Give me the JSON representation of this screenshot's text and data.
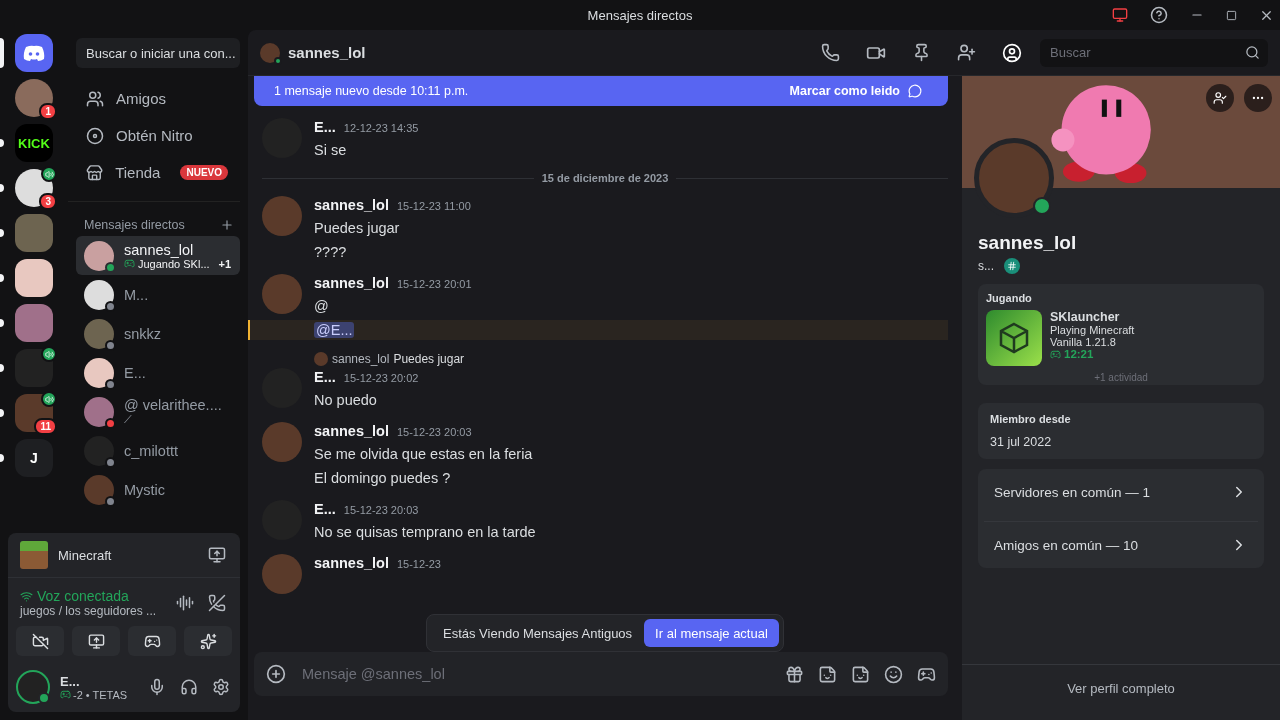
{
  "window": {
    "title": "Mensajes directos"
  },
  "servers": [
    {
      "kind": "home",
      "unread": false,
      "selected": true
    },
    {
      "kind": "avatar",
      "badge": "1",
      "voice": false,
      "unread": false,
      "selected": false
    },
    {
      "kind": "text",
      "label": "KICK",
      "unread": true,
      "selected": false
    },
    {
      "kind": "avatar",
      "badge": "3",
      "voice": true,
      "unread": true,
      "selected": false
    },
    {
      "kind": "avatar",
      "voice": false,
      "unread": true,
      "selected": false
    },
    {
      "kind": "avatar",
      "voice": false,
      "unread": true,
      "selected": false
    },
    {
      "kind": "avatar",
      "voice": false,
      "unread": true,
      "selected": false
    },
    {
      "kind": "avatar",
      "voice": true,
      "unread": true,
      "selected": false
    },
    {
      "kind": "avatar",
      "badge": "11",
      "voice": true,
      "unread": true,
      "selected": false
    },
    {
      "kind": "letter",
      "label": "J",
      "unread": true,
      "selected": false
    }
  ],
  "sidebar": {
    "search": "Buscar o iniciar una con...",
    "nav": [
      {
        "kind": "friends",
        "label": "Amigos"
      },
      {
        "kind": "nitro",
        "label": "Obtén Nitro"
      },
      {
        "kind": "shop",
        "label": "Tienda",
        "badge": "NUEVO"
      }
    ],
    "dm_header": "Mensajes directos",
    "dms": [
      {
        "name": "sannes_lol",
        "color": "#23a55a",
        "activity": "Jugando SKl...",
        "extra": "+1",
        "selected": true
      },
      {
        "name": "M...",
        "color": "#80848e",
        "selected": false
      },
      {
        "name": "snkkz",
        "color": "#80848e",
        "selected": false
      },
      {
        "name": "E...",
        "color": "#80848e",
        "selected": false
      },
      {
        "name": "@ velarithee....",
        "color": "#f23f43",
        "activity": "⟋",
        "selected": false
      },
      {
        "name": "c_milottt",
        "color": "#80848e",
        "selected": false
      },
      {
        "name": "Mystic",
        "color": "#80848e",
        "selected": false
      }
    ]
  },
  "activity_panel": {
    "game": "Minecraft",
    "voice_status": "Voz conectada",
    "voice_channel": "juegos / los seguidores ...",
    "user": {
      "name": "E...",
      "subtitle": "-2 • TETAS"
    }
  },
  "chat": {
    "recipient": "sannes_lol",
    "search_placeholder": "Buscar",
    "banner": {
      "text": "1 mensaje nuevo desde 10:11 p.m.",
      "action": "Marcar como leido"
    },
    "items": [
      {
        "kind": "message",
        "author": "E...",
        "time": "12-12-23 14:35",
        "lines": [
          {
            "text": "Si se",
            "mention": false
          }
        ]
      },
      {
        "kind": "divider",
        "text": "15 de diciembre de 2023"
      },
      {
        "kind": "message",
        "author": "sannes_lol",
        "time": "15-12-23 11:00",
        "lines": [
          {
            "text": "Puedes jugar",
            "mention": false
          },
          {
            "text": "????",
            "mention": false
          }
        ]
      },
      {
        "kind": "message",
        "author": "sannes_lol",
        "time": "15-12-23 20:01",
        "lines": [
          {
            "text": "@",
            "mention": false
          },
          {
            "text": "@E...",
            "mention": true
          }
        ]
      },
      {
        "kind": "message",
        "author": "E...",
        "time": "15-12-23 20:02",
        "reply": {
          "author": "sannes_lol",
          "text": "Puedes jugar"
        },
        "lines": [
          {
            "text": "No puedo",
            "mention": false
          }
        ]
      },
      {
        "kind": "message",
        "author": "sannes_lol",
        "time": "15-12-23 20:03",
        "lines": [
          {
            "text": "Se me olvida que estas en la feria",
            "mention": false
          },
          {
            "text": "El domingo puedes ?",
            "mention": false
          }
        ]
      },
      {
        "kind": "message",
        "author": "E...",
        "time": "15-12-23 20:03",
        "lines": [
          {
            "text": "No se quisas temprano en la tarde",
            "mention": false
          }
        ]
      },
      {
        "kind": "message",
        "author": "sannes_lol",
        "time": "15-12-23"
      }
    ],
    "toast": {
      "text": "Estás Viendo Mensajes Antiguos",
      "action": "Ir al mensaje actual"
    },
    "composer": {
      "placeholder": "Mensaje @sannes_lol"
    }
  },
  "profile": {
    "name": "sannes_lol",
    "tag": "s...",
    "activity": {
      "heading": "Jugando",
      "title": "SKlauncher",
      "details": [
        "Playing Minecraft",
        "Vanilla 1.21.8"
      ],
      "elapsed": "12:21",
      "more": "+1 actividad"
    },
    "member_since": {
      "label": "Miembro desde",
      "value": "31 jul 2022"
    },
    "links": [
      "Servidores en común — 1",
      "Amigos en común — 10"
    ],
    "footer": "Ver perfil completo"
  }
}
